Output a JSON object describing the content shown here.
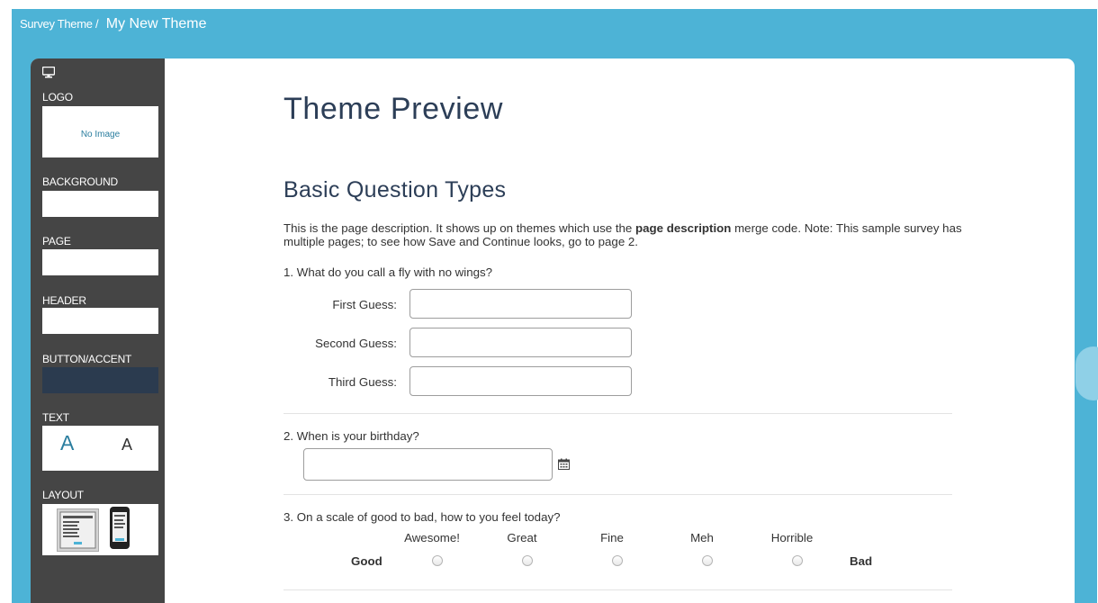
{
  "topbar": {
    "breadcrumb": "Survey Theme /",
    "title": "My New Theme"
  },
  "sidebar": {
    "logo_label": "LOGO",
    "logo_placeholder": "No Image",
    "background_label": "BACKGROUND",
    "page_label": "PAGE",
    "header_label": "HEADER",
    "button_label": "BUTTON/ACCENT",
    "text_label": "TEXT",
    "text_large": "A",
    "text_small": "A",
    "layout_label": "LAYOUT",
    "colors": {
      "background": "#ffffff",
      "page": "#ffffff",
      "header": "#ffffff",
      "button_accent": "#2b3b4f"
    }
  },
  "preview": {
    "title": "Theme Preview",
    "subtitle": "Basic Question Types",
    "desc_before": "This is the page description. It shows up on themes which use the ",
    "desc_bold": "page description",
    "desc_after": " merge code. Note: This sample survey has multiple pages; to see how Save and Continue looks, go to page 2.",
    "q1": {
      "text": "1. What do you call a fly with no wings?",
      "rows": [
        "First Guess:",
        "Second Guess:",
        "Third Guess:"
      ]
    },
    "q2": {
      "text": "2. When is your birthday?"
    },
    "q3": {
      "text": "3. On a scale of good to bad, how to you feel today?",
      "options": [
        "Awesome!",
        "Great",
        "Fine",
        "Meh",
        "Horrible"
      ],
      "left": "Good",
      "right": "Bad"
    }
  },
  "colors": {
    "accent": "#4db3d6",
    "sidebar": "#454545",
    "heading": "#2c3e57"
  }
}
